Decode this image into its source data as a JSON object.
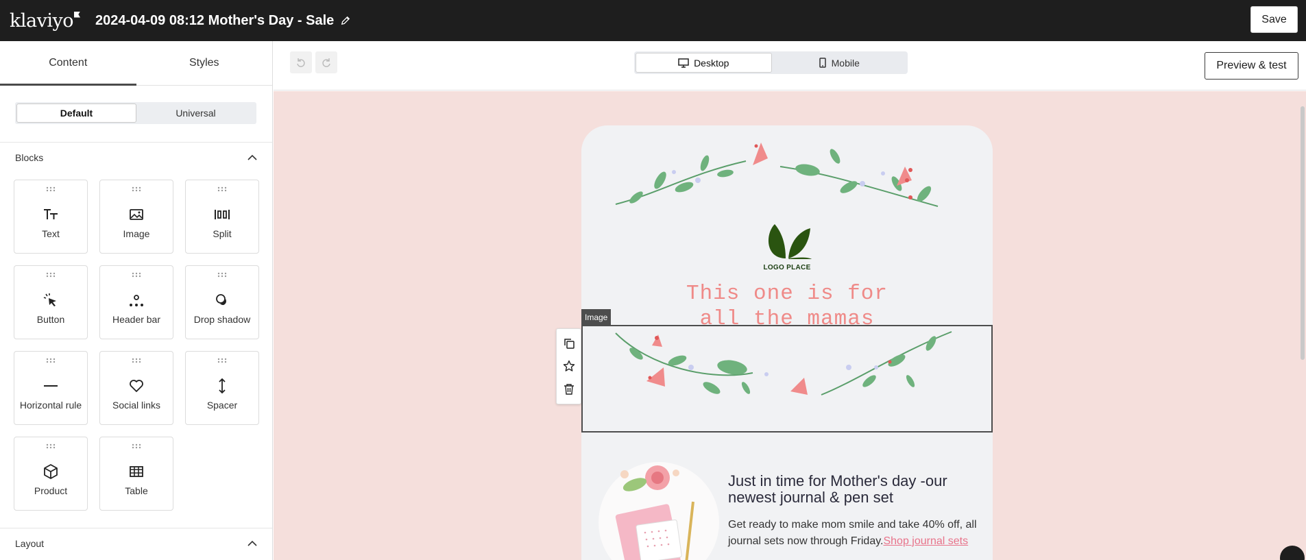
{
  "app": {
    "logo_text": "klaviyo",
    "doc_title": "2024-04-09 08:12 Mother's Day - Sale",
    "save_label": "Save"
  },
  "left_panel": {
    "tabs": [
      {
        "label": "Content",
        "active": true
      },
      {
        "label": "Styles",
        "active": false
      }
    ],
    "segment": [
      {
        "label": "Default",
        "active": true
      },
      {
        "label": "Universal",
        "active": false
      }
    ],
    "blocks_heading": "Blocks",
    "layout_heading": "Layout",
    "blocks": [
      {
        "label": "Text",
        "icon": "text-icon"
      },
      {
        "label": "Image",
        "icon": "image-icon"
      },
      {
        "label": "Split",
        "icon": "split-icon"
      },
      {
        "label": "Button",
        "icon": "button-cursor-icon"
      },
      {
        "label": "Header bar",
        "icon": "header-bar-icon"
      },
      {
        "label": "Drop shadow",
        "icon": "drop-shadow-icon"
      },
      {
        "label": "Horizontal rule",
        "icon": "horizontal-rule-icon"
      },
      {
        "label": "Social links",
        "icon": "heart-icon"
      },
      {
        "label": "Spacer",
        "icon": "spacer-icon"
      },
      {
        "label": "Product",
        "icon": "cube-icon"
      },
      {
        "label": "Table",
        "icon": "table-icon"
      }
    ]
  },
  "canvas_header": {
    "views": [
      {
        "label": "Desktop",
        "active": true,
        "icon": "desktop-icon"
      },
      {
        "label": "Mobile",
        "active": false,
        "icon": "mobile-icon"
      }
    ],
    "preview_label": "Preview & test"
  },
  "email": {
    "logo_caption": "LOGO PLACE",
    "headline_line1": "This one is for",
    "headline_line2": "all the mamas",
    "selected_block_tag": "Image",
    "product_title": "Just in time for Mother's day -our newest journal & pen set",
    "product_body": "Get ready to make mom smile and take 40% off, all journal sets now through Friday.",
    "product_link": "Shop journal sets"
  },
  "colors": {
    "topbar": "#1e1e1e",
    "canvas_bg": "#f5dfdc",
    "email_bg": "#f1f2f4",
    "headline": "#ef8a88",
    "link": "#e8738a",
    "logo_green": "#2a5410"
  }
}
